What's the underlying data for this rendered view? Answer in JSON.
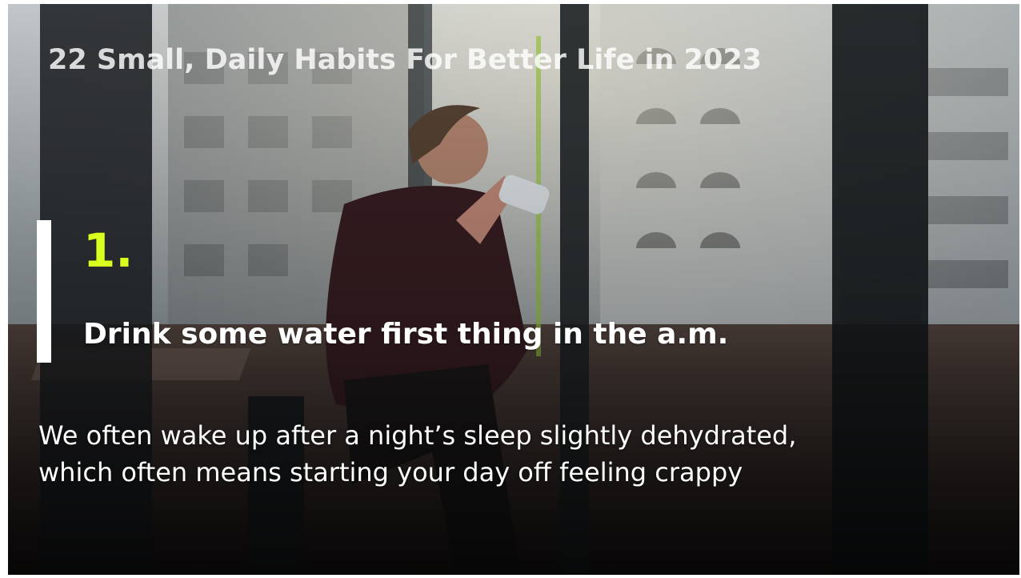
{
  "slide": {
    "title": "22 Small, Daily Habits For Better Life in 2023",
    "number": "1.",
    "habit": "Drink some water first thing in the a.m.",
    "description_lines": [
      "We often wake up after a night’s sleep slightly dehydrated,",
      "which often means starting your day off feeling crappy"
    ]
  },
  "colors": {
    "accent_number": "#d9ff1f",
    "accent_bar": "#ffffff",
    "text": "#ffffff"
  }
}
